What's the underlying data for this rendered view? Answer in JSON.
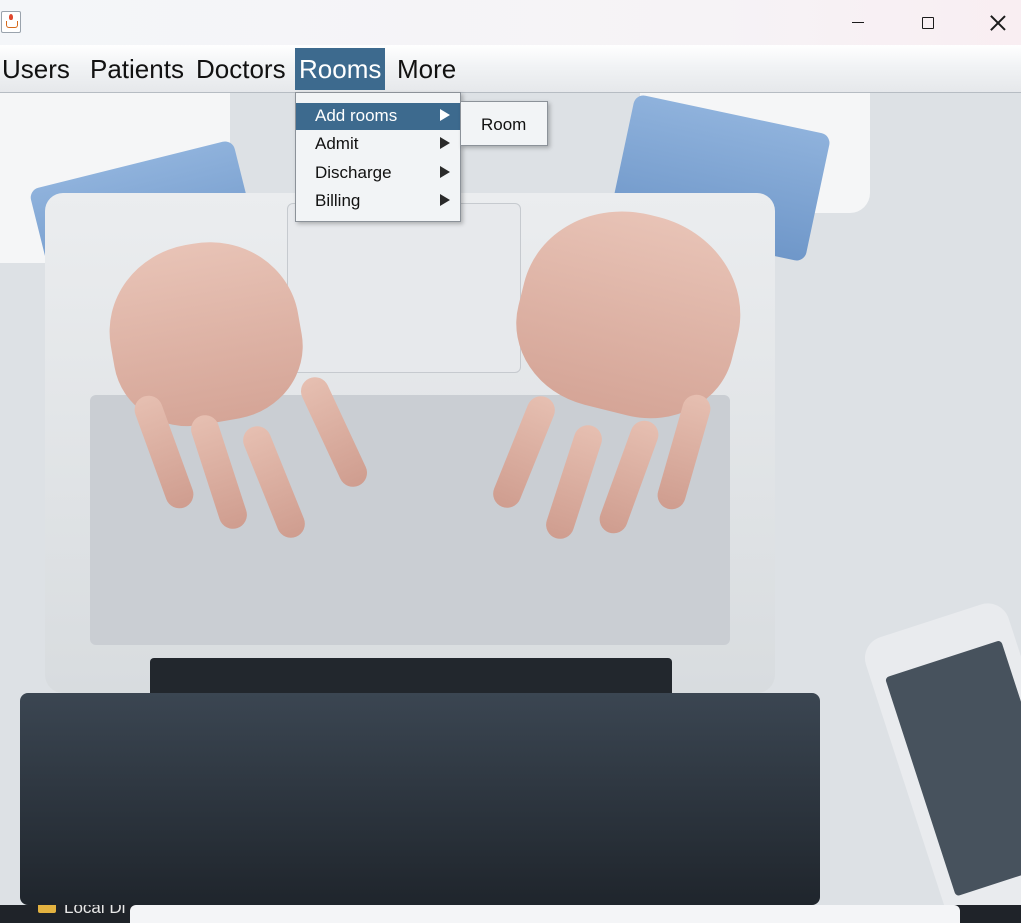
{
  "window": {
    "app_icon": "java-icon",
    "controls": {
      "minimize": "minimize-icon",
      "maximize": "maximize-icon",
      "close": "close-icon"
    }
  },
  "menubar": {
    "items": [
      {
        "label": "Users"
      },
      {
        "label": "Patients"
      },
      {
        "label": "Doctors"
      },
      {
        "label": "Rooms",
        "active": true
      },
      {
        "label": "More"
      }
    ]
  },
  "rooms_menu": {
    "items": [
      {
        "label": "Add rooms",
        "active": true,
        "has_submenu": true
      },
      {
        "label": "Admit",
        "has_submenu": true
      },
      {
        "label": "Discharge",
        "has_submenu": true
      },
      {
        "label": "Billing",
        "has_submenu": true
      }
    ]
  },
  "add_rooms_submenu": {
    "items": [
      {
        "label": "Room"
      }
    ]
  },
  "taskbar": {
    "partial_text": "Local Di"
  },
  "colors": {
    "menu_highlight": "#3d6a8e",
    "menu_background": "#f2f4f6"
  }
}
